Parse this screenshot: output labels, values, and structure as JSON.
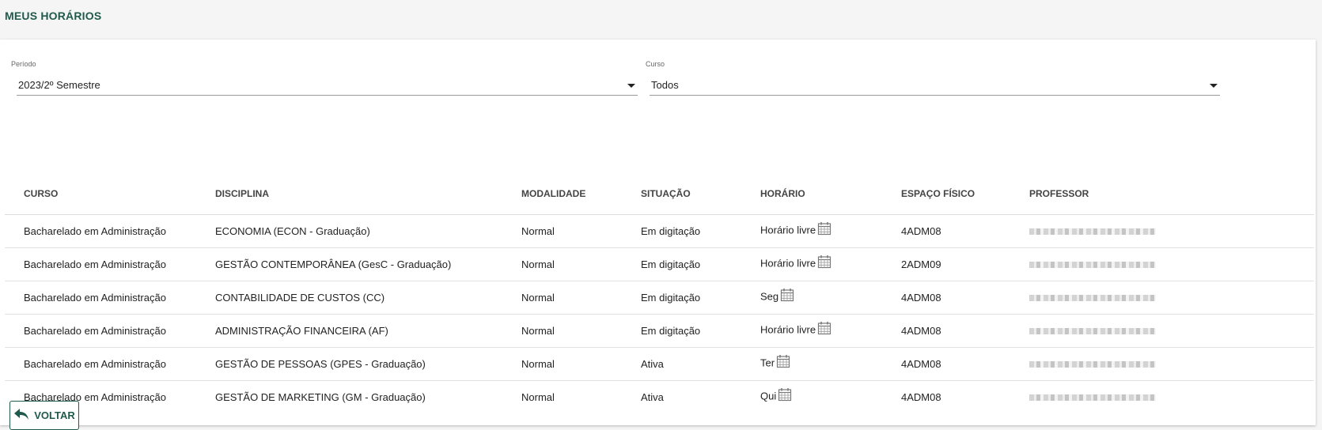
{
  "page": {
    "title": "MEUS HORÁRIOS"
  },
  "filters": {
    "periodo": {
      "label": "Período",
      "value": "2023/2º Semestre"
    },
    "curso": {
      "label": "Curso",
      "value": "Todos"
    }
  },
  "table": {
    "headers": [
      "CURSO",
      "DISCIPLINA",
      "MODALIDADE",
      "SITUAÇÃO",
      "HORÁRIO",
      "ESPAÇO FÍSICO",
      "PROFESSOR"
    ],
    "rows": [
      {
        "curso": "Bacharelado em Administração",
        "disciplina": "ECONOMIA (ECON - Graduação)",
        "modalidade": "Normal",
        "situacao": "Em digitação",
        "horario": "Horário livre",
        "espaco": "4ADM08"
      },
      {
        "curso": "Bacharelado em Administração",
        "disciplina": "GESTÃO CONTEMPORÂNEA (GesC - Graduação)",
        "modalidade": "Normal",
        "situacao": "Em digitação",
        "horario": "Horário livre",
        "espaco": "2ADM09"
      },
      {
        "curso": "Bacharelado em Administração",
        "disciplina": "CONTABILIDADE DE CUSTOS (CC)",
        "modalidade": "Normal",
        "situacao": "Em digitação",
        "horario": "Seg",
        "espaco": "4ADM08"
      },
      {
        "curso": "Bacharelado em Administração",
        "disciplina": "ADMINISTRAÇÃO FINANCEIRA (AF)",
        "modalidade": "Normal",
        "situacao": "Em digitação",
        "horario": "Horário livre",
        "espaco": "4ADM08"
      },
      {
        "curso": "Bacharelado em Administração",
        "disciplina": "GESTÃO DE PESSOAS (GPES - Graduação)",
        "modalidade": "Normal",
        "situacao": "Ativa",
        "horario": "Ter",
        "espaco": "4ADM08"
      },
      {
        "curso": "Bacharelado em Administração",
        "disciplina": "GESTÃO DE MARKETING (GM - Graduação)",
        "modalidade": "Normal",
        "situacao": "Ativa",
        "horario": "Qui",
        "espaco": "4ADM08"
      }
    ]
  },
  "actions": {
    "back_label": "VOLTAR"
  },
  "icons": {
    "schedule": "calendar-icon",
    "back": "undo-arrow-icon",
    "dropdown": "caret-down-icon"
  },
  "colors": {
    "accent": "#1f5a4c"
  }
}
